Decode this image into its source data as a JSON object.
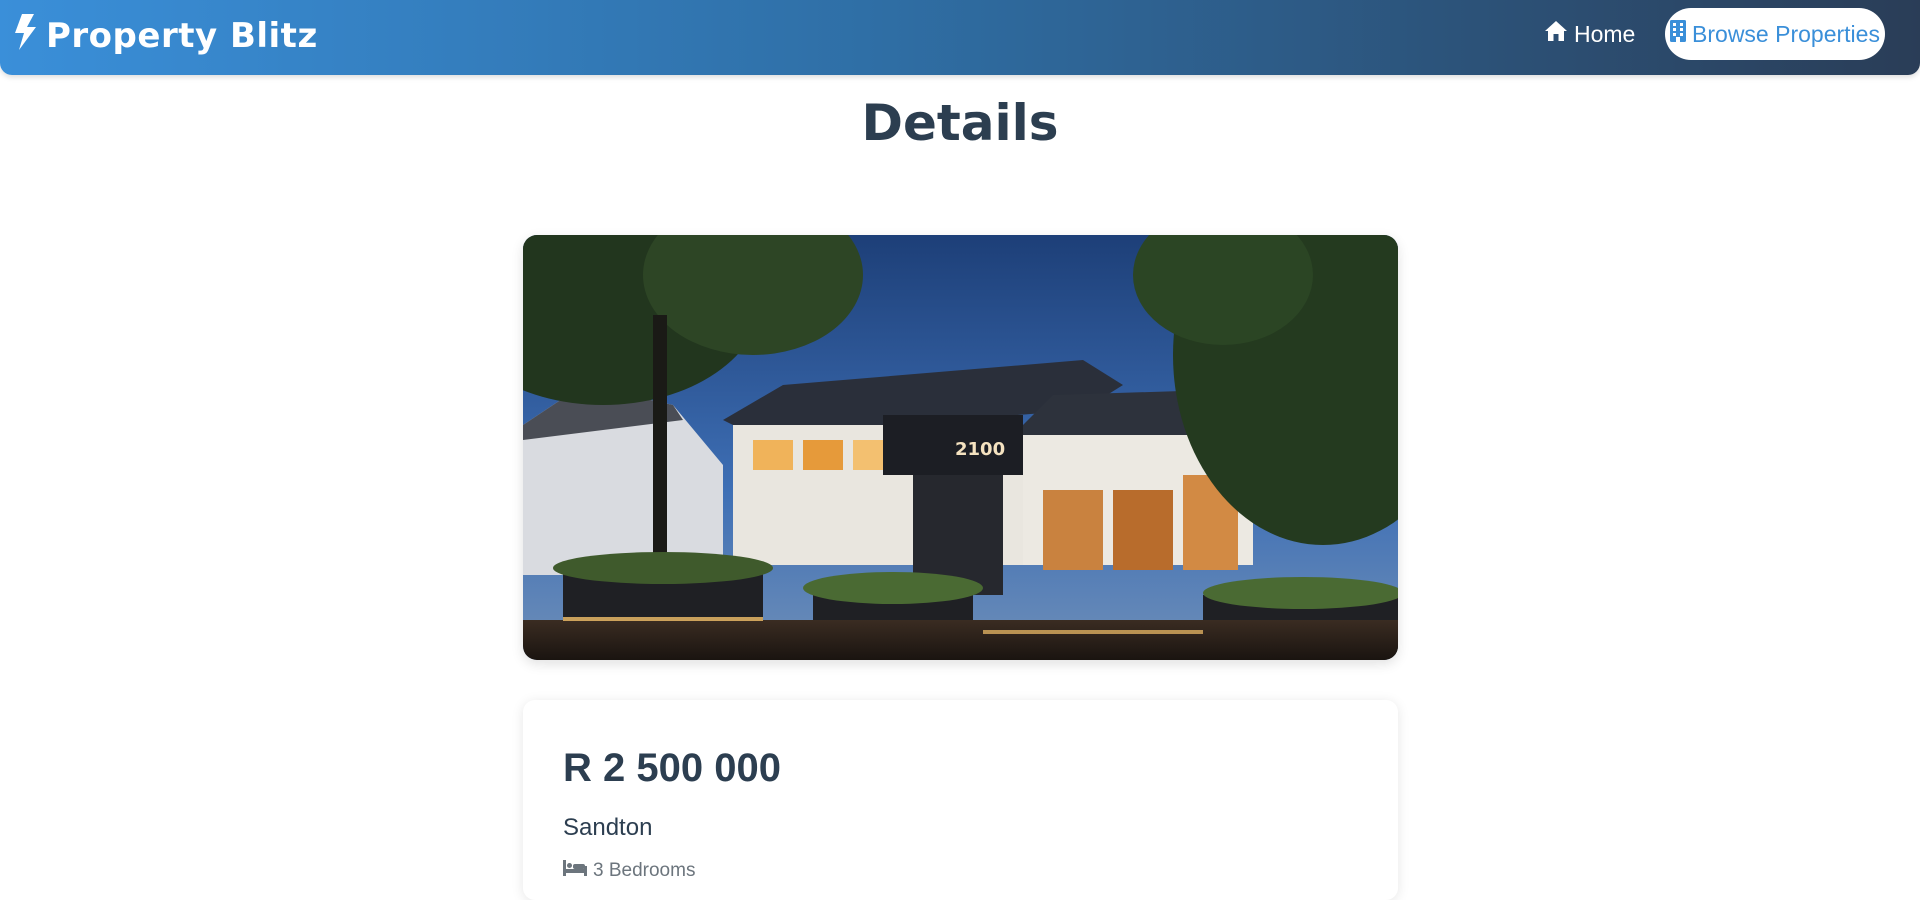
{
  "navbar": {
    "brand": "Property Blitz",
    "home_label": "Home",
    "browse_label": "Browse Properties",
    "colors": {
      "gradient_start": "#3a8fd9",
      "gradient_end": "#2a3d57",
      "active_text": "#3a8fd9"
    }
  },
  "page": {
    "title": "Details"
  },
  "property": {
    "image_icon": "property-photo",
    "price": "R 2 500 000",
    "location": "Sandton",
    "bedrooms": "3 Bedrooms"
  },
  "icons": {
    "brand": "bolt-icon",
    "home": "home-icon",
    "browse": "building-icon",
    "bedrooms": "bed-icon"
  }
}
